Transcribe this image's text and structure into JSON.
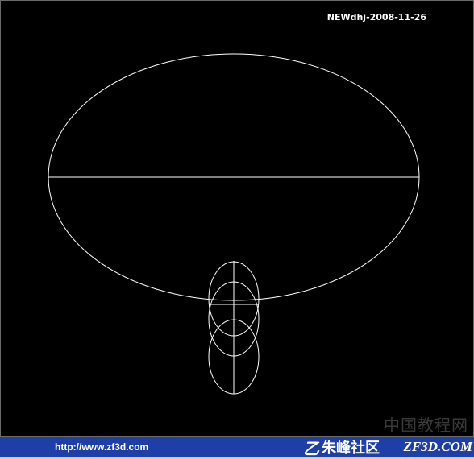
{
  "drawing": {
    "stamp_text": "NEWdhj-2008-11-26",
    "watermark_text": "中国教程网",
    "colors": {
      "background": "#000000",
      "lines": "#ffffff",
      "footer": "#1e3ea8"
    }
  },
  "footer": {
    "url_text": "http://www.zf3d.com",
    "logo_mark": "乙",
    "logo_text": "朱峰社区",
    "site_text": "ZF3D.COM"
  }
}
